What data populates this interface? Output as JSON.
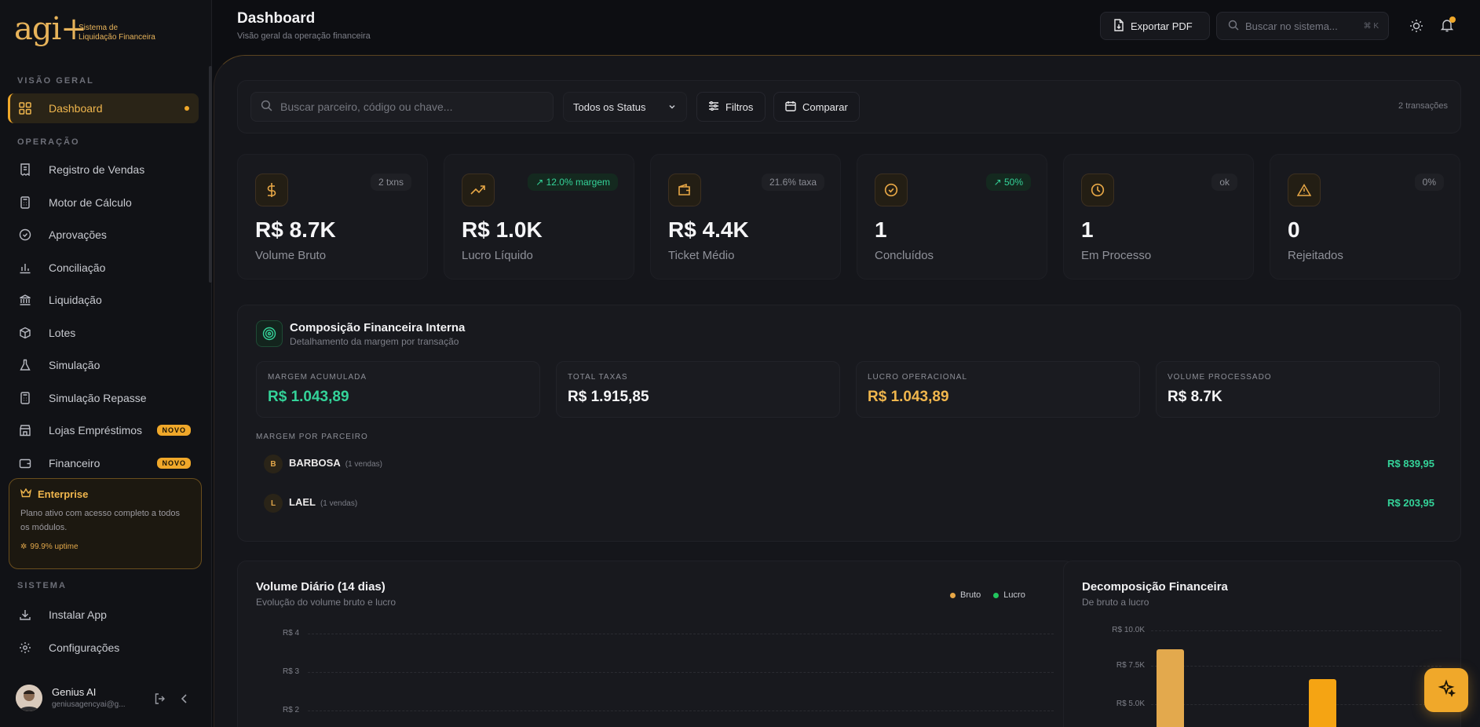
{
  "brand": {
    "logo": "agi+",
    "sub_line1": "Sistema de",
    "sub_line2": "Liquidação Financeira"
  },
  "sidebar": {
    "section_visao": "VISÃO GERAL",
    "section_operacao": "OPERAÇÃO",
    "section_sistema": "SISTEMA",
    "items": [
      {
        "label": "Dashboard",
        "icon": "grid-icon"
      },
      {
        "label": "Registro de Vendas",
        "icon": "receipt-icon"
      },
      {
        "label": "Motor de Cálculo",
        "icon": "calculator-icon"
      },
      {
        "label": "Aprovações",
        "icon": "check-circle-icon"
      },
      {
        "label": "Conciliação",
        "icon": "bar-chart-icon"
      },
      {
        "label": "Liquidação",
        "icon": "bank-icon"
      },
      {
        "label": "Lotes",
        "icon": "package-icon"
      },
      {
        "label": "Simulação",
        "icon": "flask-icon"
      },
      {
        "label": "Simulação Repasse",
        "icon": "calculator-icon"
      },
      {
        "label": "Lojas Empréstimos",
        "icon": "store-icon",
        "badge": "NOVO"
      },
      {
        "label": "Financeiro",
        "icon": "wallet-icon",
        "badge": "NOVO"
      }
    ],
    "system_items": [
      {
        "label": "Instalar App",
        "icon": "download-icon"
      },
      {
        "label": "Configurações",
        "icon": "gear-icon"
      }
    ],
    "enterprise": {
      "title": "Enterprise",
      "desc": "Plano ativo com acesso completo a todos os módulos.",
      "uptime": "99.9% uptime"
    },
    "user": {
      "name": "Genius AI",
      "email": "geniusagencyai@g..."
    }
  },
  "header": {
    "title": "Dashboard",
    "subtitle": "Visão geral da operação financeira",
    "export_label": "Exportar PDF",
    "search_placeholder": "Buscar no sistema...",
    "search_shortcut": "⌘ K"
  },
  "toolbar": {
    "search_placeholder": "Buscar parceiro, código ou chave...",
    "status_select": "Todos os Status",
    "filters_label": "Filtros",
    "compare_label": "Comparar",
    "count": "2 transações"
  },
  "kpis": [
    {
      "value": "R$ 8.7K",
      "label": "Volume Bruto",
      "tag": "2 txns",
      "icon": "dollar-icon",
      "tag_style": "neutral"
    },
    {
      "value": "R$ 1.0K",
      "label": "Lucro Líquido",
      "tag": "12.0% margem",
      "icon": "trending-up-icon",
      "tag_style": "green"
    },
    {
      "value": "R$ 4.4K",
      "label": "Ticket Médio",
      "tag": "21.6% taxa",
      "icon": "wallet-icon",
      "tag_style": "neutral"
    },
    {
      "value": "1",
      "label": "Concluídos",
      "tag": "50%",
      "icon": "check-circle-icon",
      "tag_style": "green"
    },
    {
      "value": "1",
      "label": "Em Processo",
      "tag": "ok",
      "icon": "clock-icon",
      "tag_style": "neutral"
    },
    {
      "value": "0",
      "label": "Rejeitados",
      "tag": "0%",
      "icon": "warning-icon",
      "tag_style": "neutral"
    }
  ],
  "composicao": {
    "title": "Composição Financeira Interna",
    "subtitle": "Detalhamento da margem por transação",
    "metrics": [
      {
        "label": "MARGEM ACUMULADA",
        "value": "R$ 1.043,89",
        "color": "#34d399"
      },
      {
        "label": "TOTAL TAXAS",
        "value": "R$ 1.915,85",
        "color": "#f5f5f7"
      },
      {
        "label": "LUCRO OPERACIONAL",
        "value": "R$ 1.043,89",
        "color": "#f0b64d"
      },
      {
        "label": "VOLUME PROCESSADO",
        "value": "R$ 8.7K",
        "color": "#f5f5f7"
      }
    ],
    "partners_label": "MARGEM POR PARCEIRO",
    "partners": [
      {
        "initial": "B",
        "name": "BARBOSA",
        "note": "(1 vendas)",
        "value": "R$ 839,95"
      },
      {
        "initial": "L",
        "name": "LAEL",
        "note": "(1 vendas)",
        "value": "R$ 203,95"
      }
    ]
  },
  "volume_chart": {
    "title": "Volume Diário (14 dias)",
    "subtitle": "Evolução do volume bruto e lucro",
    "legend": [
      "Bruto",
      "Lucro"
    ],
    "ticks": [
      "R$ 4",
      "R$ 3",
      "R$ 2"
    ]
  },
  "decomp_chart": {
    "title": "Decomposição Financeira",
    "subtitle": "De bruto a lucro",
    "ticks": [
      "R$ 10.0K",
      "R$ 7.5K",
      "R$ 5.0K"
    ],
    "bar_colors": [
      "#e3a94d",
      "#f5a413"
    ]
  },
  "chart_data": [
    {
      "type": "line",
      "title": "Volume Diário (14 dias)",
      "series": [
        {
          "name": "Bruto",
          "values": []
        },
        {
          "name": "Lucro",
          "values": []
        }
      ],
      "ylim": [
        2,
        4
      ]
    },
    {
      "type": "bar",
      "title": "Decomposição Financeira",
      "values": [
        8700,
        6700
      ],
      "ylim": [
        5000,
        10000
      ]
    }
  ]
}
